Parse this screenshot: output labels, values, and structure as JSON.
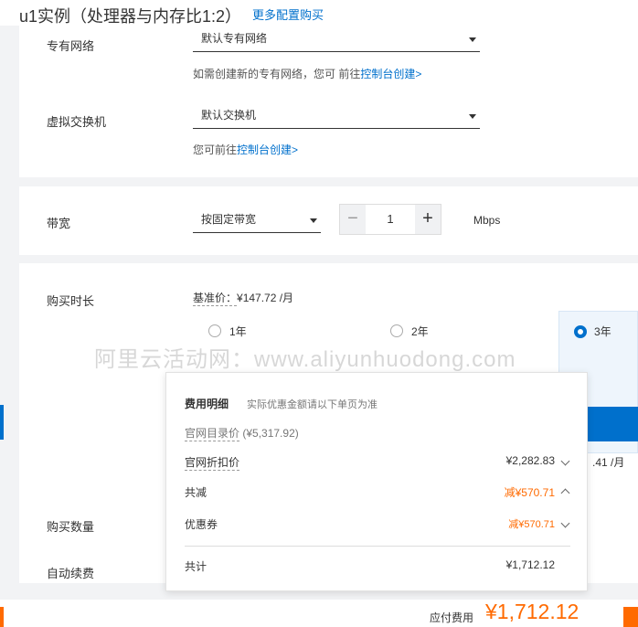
{
  "header": {
    "title": "u1实例（处理器与内存比1:2）",
    "more_link": "更多配置购买"
  },
  "network": {
    "vpc_label": "专有网络",
    "vpc_value": "默认专有网络",
    "vpc_hint_prefix": "如需创建新的专有网络，您可 前往",
    "vpc_hint_link": "控制台创建>",
    "vswitch_label": "虚拟交换机",
    "vswitch_value": "默认交换机",
    "vswitch_hint_prefix": "您可前往",
    "vswitch_hint_link": "控制台创建>"
  },
  "bandwidth": {
    "label": "带宽",
    "mode": "按固定带宽",
    "minus": "−",
    "value": "1",
    "plus": "+",
    "unit": "Mbps"
  },
  "duration": {
    "label": "购买时长",
    "base_price_label": "基准价：",
    "base_price_value": "¥147.72 /月",
    "options": [
      {
        "label": "1年",
        "selected": false
      },
      {
        "label": "2年",
        "selected": false
      },
      {
        "label": "3年",
        "selected": true
      }
    ],
    "monthly_partial": ".41 /月"
  },
  "quantity_label": "购买数量",
  "auto_renew_label": "自动续费",
  "watermark": "阿里云活动网：www.aliyunhuodong.com",
  "popover": {
    "title": "费用明细",
    "subtitle": "实际优惠金额请以下单页为准",
    "list_price_label": "官网目录价",
    "list_price_value": "(¥5,317.92)",
    "discount_label": "官网折扣价",
    "discount_value": "¥2,282.83",
    "reduction_label": "共减",
    "reduction_value": "减¥570.71",
    "coupon_label": "优惠券",
    "coupon_value": "减¥570.71",
    "total_label": "共计",
    "total_value": "¥1,712.12"
  },
  "footer": {
    "pay_label": "应付费用",
    "pay_value": "¥1,712.12"
  },
  "colors": {
    "accent": "#0070cc",
    "orange": "#ff6a00"
  }
}
